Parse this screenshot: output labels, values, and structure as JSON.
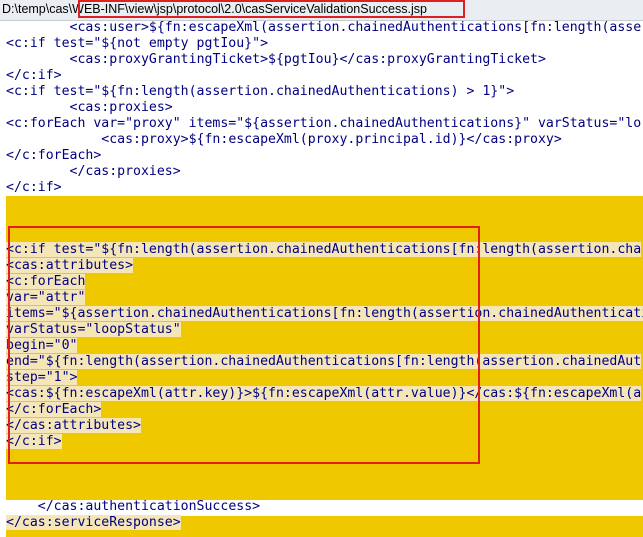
{
  "window": {
    "title_path": "D:\\temp\\cas\\WEB-INF\\view\\jsp\\protocol\\2.0\\casServiceValidationSuccess.jsp"
  },
  "colors": {
    "tag": "#000080",
    "highlight_band": "#f0c800",
    "line_highlight": "#f5e6b8",
    "annotation_box": "#e02020"
  },
  "editor": {
    "lines": [
      {
        "indent": "        ",
        "text": "<cas:user>${fn:escapeXml(assertion.chainedAuthentications[fn:length(asse"
      },
      {
        "indent": "",
        "text": "<c:if test=\"${not empty pgtIou}\">"
      },
      {
        "indent": "        ",
        "text": "<cas:proxyGrantingTicket>${pgtIou}</cas:proxyGrantingTicket>"
      },
      {
        "indent": "",
        "text": "</c:if>"
      },
      {
        "indent": "",
        "text": "<c:if test=\"${fn:length(assertion.chainedAuthentications) > 1}\">"
      },
      {
        "indent": "        ",
        "text": "<cas:proxies>"
      },
      {
        "indent": "",
        "text": "<c:forEach var=\"proxy\" items=\"${assertion.chainedAuthentications}\" varStatus=\"lo"
      },
      {
        "indent": "            ",
        "text": "<cas:proxy>${fn:escapeXml(proxy.principal.id)}</cas:proxy>"
      },
      {
        "indent": "",
        "text": "</c:forEach>"
      },
      {
        "indent": "        ",
        "text": "</cas:proxies>"
      },
      {
        "indent": "",
        "text": "</c:if>"
      },
      {
        "indent": "",
        "text": "<c:if test=\"${fn:length(assertion.chainedAuthentications[fn:length(assertion.cha"
      },
      {
        "indent": "",
        "text": "<cas:attributes>"
      },
      {
        "indent": "",
        "text": "<c:forEach"
      },
      {
        "indent": "",
        "text": "var=\"attr\""
      },
      {
        "indent": "",
        "text": "items=\"${assertion.chainedAuthentications[fn:length(assertion.chainedAuthenticati"
      },
      {
        "indent": "",
        "text": "varStatus=\"loopStatus\""
      },
      {
        "indent": "",
        "text": "begin=\"0\""
      },
      {
        "indent": "",
        "text": "end=\"${fn:length(assertion.chainedAuthentications[fn:length(assertion.chainedAut"
      },
      {
        "indent": "",
        "text": "step=\"1\">"
      },
      {
        "indent": "",
        "text": "<cas:${fn:escapeXml(attr.key)}>${fn:escapeXml(attr.value)}</cas:${fn:escapeXml(a"
      },
      {
        "indent": "",
        "text": "</c:forEach>"
      },
      {
        "indent": "",
        "text": "</cas:attributes>"
      },
      {
        "indent": "",
        "text": "</c:if>"
      },
      {
        "indent": "    ",
        "text": "</cas:authenticationSuccess>"
      },
      {
        "indent": "",
        "text": "</cas:serviceResponse>"
      }
    ]
  }
}
